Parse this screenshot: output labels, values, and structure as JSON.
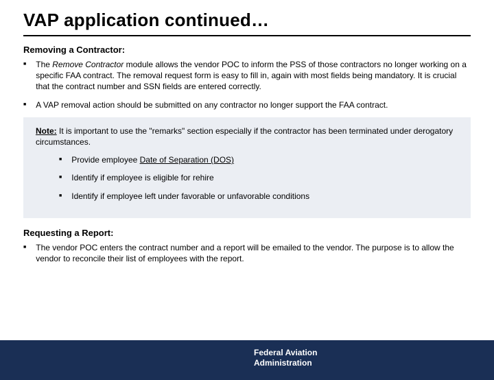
{
  "title": "VAP application continued…",
  "removing": {
    "heading": "Removing a Contractor:",
    "b1_pre": "The ",
    "b1_em": "Remove Contractor",
    "b1_post": " module allows the vendor POC to inform the PSS of those contractors no longer working on a specific FAA contract.  The removal request form is easy to fill in, again with most fields being mandatory.  It is crucial that the contract number and SSN fields are entered correctly.",
    "b2": "A VAP removal action should be submitted on any contractor no longer support the FAA contract."
  },
  "note": {
    "label": "Note:",
    "text": " It is important to use the \"remarks\" section especially if the contractor has been terminated under derogatory circumstances.",
    "i1_pre": "Provide employee ",
    "i1_ul": "Date of Separation (DOS)",
    "i2": "Identify if employee is eligible for rehire",
    "i3": "Identify if employee left under favorable or unfavorable conditions"
  },
  "report": {
    "heading": "Requesting a Report:",
    "b1": "The vendor POC enters the contract number and a report will be emailed to the vendor.  The purpose is to allow the vendor to reconcile their list of employees with the report."
  },
  "footer": {
    "line1": "Federal Aviation",
    "line2": "Administration"
  }
}
